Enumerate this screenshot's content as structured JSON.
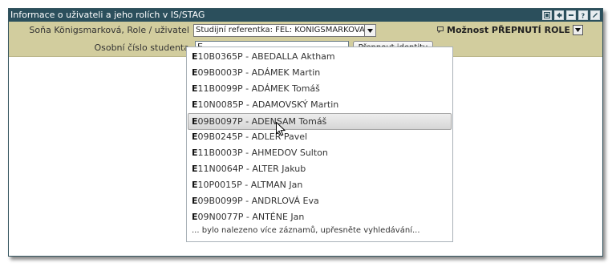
{
  "window": {
    "title": "Informace o uživateli a jeho rolích v IS/STAG",
    "icons": [
      "window-icon",
      "back-icon",
      "minimize-icon",
      "help-icon",
      "edit-icon"
    ]
  },
  "header": {
    "user_label": "Soňa Königsmarková, Role / uživatel",
    "role_select_value": "Studijní referentka: FEL: KONIGSMARKOVA",
    "switch_role_label": "Možnost PŘEPNUTÍ ROLE",
    "id_label": "Osobní číslo studenta",
    "id_input_value": "E",
    "switch_identity_button": "Přepnout identitu"
  },
  "autocomplete": {
    "items": [
      {
        "prefix": "E",
        "rest": "10B0365P - ABEDALLA Aktham"
      },
      {
        "prefix": "E",
        "rest": "09B0003P - ADÁMEK Martin"
      },
      {
        "prefix": "E",
        "rest": "11B0099P - ADÁMEK Tomáš"
      },
      {
        "prefix": "E",
        "rest": "10N0085P - ADAMOVSKÝ Martin"
      },
      {
        "prefix": "E",
        "rest": "09B0097P - ADENSAM Tomáš"
      },
      {
        "prefix": "E",
        "rest": "09B0245P - ADLER Pavel"
      },
      {
        "prefix": "E",
        "rest": "11B0003P - AHMEDOV Sulton"
      },
      {
        "prefix": "E",
        "rest": "11N0064P - ALTER Jakub"
      },
      {
        "prefix": "E",
        "rest": "10P0015P - ALTMAN Jan"
      },
      {
        "prefix": "E",
        "rest": "09B0099P - ANDRLOVÁ Eva"
      },
      {
        "prefix": "E",
        "rest": "09N0077P - ANTÉNE Jan"
      }
    ],
    "selected_index": 4,
    "more_text": "... bylo nalezeno více záznamů, upřesněte vyhledávání..."
  },
  "colors": {
    "titlebar": "#2b4f5c",
    "header": "#d2cd9e"
  }
}
